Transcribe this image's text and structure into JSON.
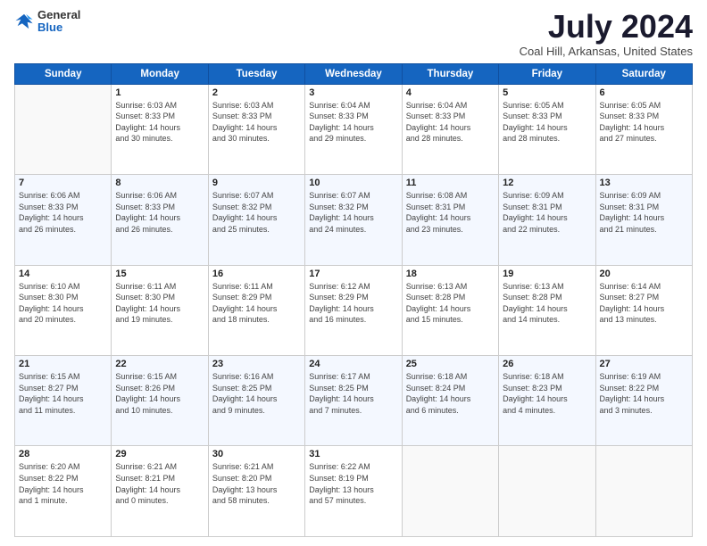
{
  "header": {
    "logo_general": "General",
    "logo_blue": "Blue",
    "title": "July 2024",
    "location": "Coal Hill, Arkansas, United States"
  },
  "days_of_week": [
    "Sunday",
    "Monday",
    "Tuesday",
    "Wednesday",
    "Thursday",
    "Friday",
    "Saturday"
  ],
  "weeks": [
    [
      {
        "day": "",
        "info": ""
      },
      {
        "day": "1",
        "info": "Sunrise: 6:03 AM\nSunset: 8:33 PM\nDaylight: 14 hours\nand 30 minutes."
      },
      {
        "day": "2",
        "info": "Sunrise: 6:03 AM\nSunset: 8:33 PM\nDaylight: 14 hours\nand 30 minutes."
      },
      {
        "day": "3",
        "info": "Sunrise: 6:04 AM\nSunset: 8:33 PM\nDaylight: 14 hours\nand 29 minutes."
      },
      {
        "day": "4",
        "info": "Sunrise: 6:04 AM\nSunset: 8:33 PM\nDaylight: 14 hours\nand 28 minutes."
      },
      {
        "day": "5",
        "info": "Sunrise: 6:05 AM\nSunset: 8:33 PM\nDaylight: 14 hours\nand 28 minutes."
      },
      {
        "day": "6",
        "info": "Sunrise: 6:05 AM\nSunset: 8:33 PM\nDaylight: 14 hours\nand 27 minutes."
      }
    ],
    [
      {
        "day": "7",
        "info": "Sunrise: 6:06 AM\nSunset: 8:33 PM\nDaylight: 14 hours\nand 26 minutes."
      },
      {
        "day": "8",
        "info": "Sunrise: 6:06 AM\nSunset: 8:33 PM\nDaylight: 14 hours\nand 26 minutes."
      },
      {
        "day": "9",
        "info": "Sunrise: 6:07 AM\nSunset: 8:32 PM\nDaylight: 14 hours\nand 25 minutes."
      },
      {
        "day": "10",
        "info": "Sunrise: 6:07 AM\nSunset: 8:32 PM\nDaylight: 14 hours\nand 24 minutes."
      },
      {
        "day": "11",
        "info": "Sunrise: 6:08 AM\nSunset: 8:31 PM\nDaylight: 14 hours\nand 23 minutes."
      },
      {
        "day": "12",
        "info": "Sunrise: 6:09 AM\nSunset: 8:31 PM\nDaylight: 14 hours\nand 22 minutes."
      },
      {
        "day": "13",
        "info": "Sunrise: 6:09 AM\nSunset: 8:31 PM\nDaylight: 14 hours\nand 21 minutes."
      }
    ],
    [
      {
        "day": "14",
        "info": "Sunrise: 6:10 AM\nSunset: 8:30 PM\nDaylight: 14 hours\nand 20 minutes."
      },
      {
        "day": "15",
        "info": "Sunrise: 6:11 AM\nSunset: 8:30 PM\nDaylight: 14 hours\nand 19 minutes."
      },
      {
        "day": "16",
        "info": "Sunrise: 6:11 AM\nSunset: 8:29 PM\nDaylight: 14 hours\nand 18 minutes."
      },
      {
        "day": "17",
        "info": "Sunrise: 6:12 AM\nSunset: 8:29 PM\nDaylight: 14 hours\nand 16 minutes."
      },
      {
        "day": "18",
        "info": "Sunrise: 6:13 AM\nSunset: 8:28 PM\nDaylight: 14 hours\nand 15 minutes."
      },
      {
        "day": "19",
        "info": "Sunrise: 6:13 AM\nSunset: 8:28 PM\nDaylight: 14 hours\nand 14 minutes."
      },
      {
        "day": "20",
        "info": "Sunrise: 6:14 AM\nSunset: 8:27 PM\nDaylight: 14 hours\nand 13 minutes."
      }
    ],
    [
      {
        "day": "21",
        "info": "Sunrise: 6:15 AM\nSunset: 8:27 PM\nDaylight: 14 hours\nand 11 minutes."
      },
      {
        "day": "22",
        "info": "Sunrise: 6:15 AM\nSunset: 8:26 PM\nDaylight: 14 hours\nand 10 minutes."
      },
      {
        "day": "23",
        "info": "Sunrise: 6:16 AM\nSunset: 8:25 PM\nDaylight: 14 hours\nand 9 minutes."
      },
      {
        "day": "24",
        "info": "Sunrise: 6:17 AM\nSunset: 8:25 PM\nDaylight: 14 hours\nand 7 minutes."
      },
      {
        "day": "25",
        "info": "Sunrise: 6:18 AM\nSunset: 8:24 PM\nDaylight: 14 hours\nand 6 minutes."
      },
      {
        "day": "26",
        "info": "Sunrise: 6:18 AM\nSunset: 8:23 PM\nDaylight: 14 hours\nand 4 minutes."
      },
      {
        "day": "27",
        "info": "Sunrise: 6:19 AM\nSunset: 8:22 PM\nDaylight: 14 hours\nand 3 minutes."
      }
    ],
    [
      {
        "day": "28",
        "info": "Sunrise: 6:20 AM\nSunset: 8:22 PM\nDaylight: 14 hours\nand 1 minute."
      },
      {
        "day": "29",
        "info": "Sunrise: 6:21 AM\nSunset: 8:21 PM\nDaylight: 14 hours\nand 0 minutes."
      },
      {
        "day": "30",
        "info": "Sunrise: 6:21 AM\nSunset: 8:20 PM\nDaylight: 13 hours\nand 58 minutes."
      },
      {
        "day": "31",
        "info": "Sunrise: 6:22 AM\nSunset: 8:19 PM\nDaylight: 13 hours\nand 57 minutes."
      },
      {
        "day": "",
        "info": ""
      },
      {
        "day": "",
        "info": ""
      },
      {
        "day": "",
        "info": ""
      }
    ]
  ]
}
